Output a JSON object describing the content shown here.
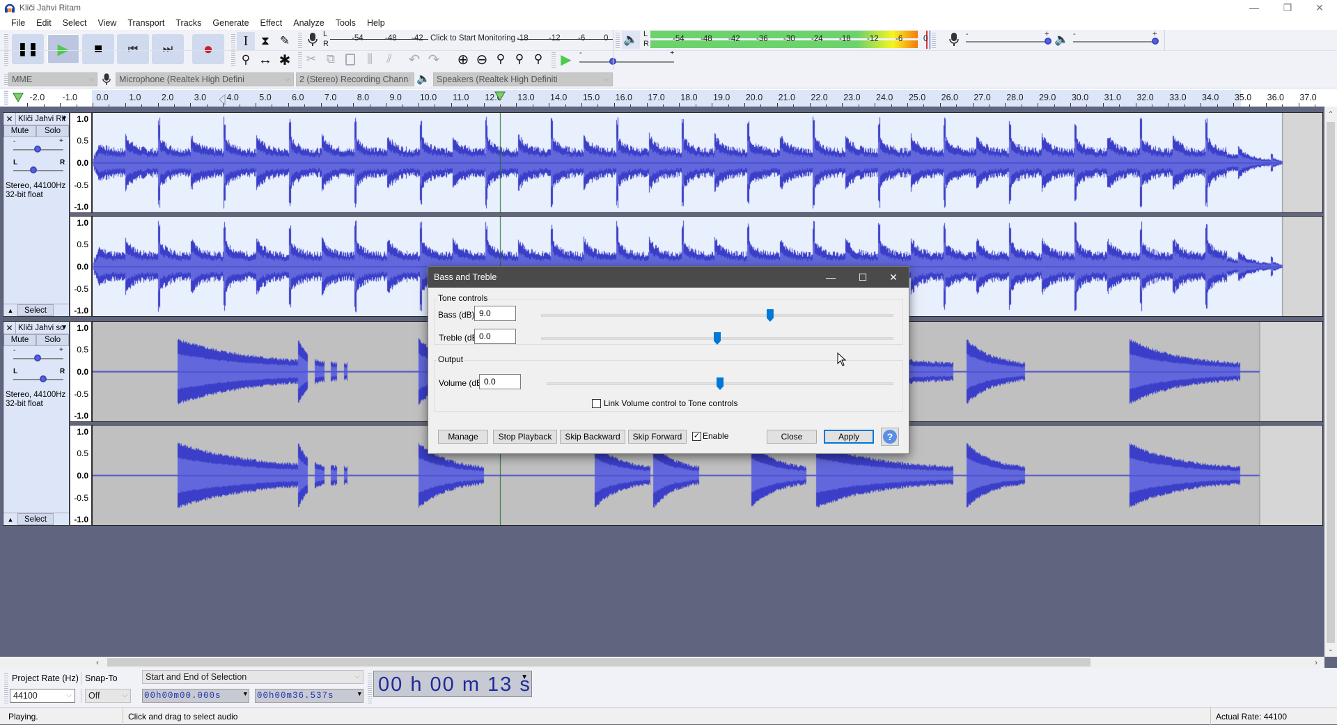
{
  "window": {
    "title": "Kliči Jahvi Ritam",
    "controls": {
      "minimize": "—",
      "restore": "❐",
      "close": "✕"
    }
  },
  "menu": [
    "File",
    "Edit",
    "Select",
    "View",
    "Transport",
    "Tracks",
    "Generate",
    "Effect",
    "Analyze",
    "Tools",
    "Help"
  ],
  "transport": {
    "buttons": [
      {
        "name": "pause",
        "glyph": "❚❚"
      },
      {
        "name": "play",
        "glyph": "▶",
        "active": true
      },
      {
        "name": "stop",
        "glyph": "■"
      },
      {
        "name": "skip-start",
        "glyph": "⏮"
      },
      {
        "name": "skip-end",
        "glyph": "⏭"
      },
      {
        "name": "record",
        "glyph": "●"
      }
    ]
  },
  "tools": {
    "row1": [
      {
        "name": "selection-tool",
        "glyph": "I",
        "selected": true
      },
      {
        "name": "envelope-tool",
        "glyph": "⧗"
      },
      {
        "name": "draw-tool",
        "glyph": "✎"
      }
    ],
    "row2": [
      {
        "name": "zoom-tool",
        "glyph": "⚲"
      },
      {
        "name": "timeshift-tool",
        "glyph": "↔"
      },
      {
        "name": "multi-tool",
        "glyph": "✱"
      }
    ]
  },
  "edit_tools": [
    {
      "name": "cut",
      "glyph": "✂"
    },
    {
      "name": "copy",
      "glyph": "⧉"
    },
    {
      "name": "paste",
      "glyph": "📋"
    },
    {
      "name": "trim",
      "glyph": "⫼"
    },
    {
      "name": "silence",
      "glyph": "⫽"
    },
    {
      "name": "undo",
      "glyph": "↶"
    },
    {
      "name": "redo",
      "glyph": "↷"
    },
    {
      "name": "zoom-in",
      "glyph": "⊕"
    },
    {
      "name": "zoom-out",
      "glyph": "⊖"
    },
    {
      "name": "fit-selection",
      "glyph": "⚲"
    },
    {
      "name": "fit-project",
      "glyph": "⚲"
    },
    {
      "name": "zoom-toggle",
      "glyph": "⚲"
    }
  ],
  "play_at_speed": {
    "glyph": "▶",
    "min": "-",
    "max": "+",
    "value_fraction": 0.35
  },
  "record_meter": {
    "L": "L",
    "R": "R",
    "ticks": [
      "-54",
      "-48",
      "-42",
      "-18",
      "-12",
      "-6",
      "0"
    ],
    "prompt": "Click to Start Monitoring"
  },
  "playback_meter": {
    "L": "L",
    "R": "R",
    "ticks": [
      "-54",
      "-48",
      "-42",
      "-36",
      "-30",
      "-24",
      "-18",
      "-12",
      "-6",
      "0"
    ],
    "colors": {
      "green": "#6cd26c",
      "yellow": "#f5f51e",
      "orange": "#f57a10",
      "peak": "#e23030"
    }
  },
  "mixer": {
    "record_volume": {
      "min": "-",
      "max": "+",
      "value_fraction": 1.0
    },
    "playback_volume": {
      "min": "-",
      "max": "+",
      "value_fraction": 1.0
    }
  },
  "device": {
    "host": "MME",
    "recording_device": "Microphone (Realtek High Defini",
    "channels": "2 (Stereo) Recording Chann",
    "playback_device": "Speakers (Realtek High Definiti"
  },
  "ruler": {
    "ticks": [
      "-2.0",
      "-1.0",
      "0.0",
      "1.0",
      "2.0",
      "3.0",
      "4.0",
      "5.0",
      "6.0",
      "7.0",
      "8.0",
      "9.0",
      "10.0",
      "11.0",
      "12.0",
      "13.0",
      "14.0",
      "15.0",
      "16.0",
      "17.0",
      "18.0",
      "19.0",
      "20.0",
      "21.0",
      "22.0",
      "23.0",
      "24.0",
      "25.0",
      "26.0",
      "27.0",
      "28.0",
      "29.0",
      "30.0",
      "31.0",
      "32.0",
      "33.0",
      "34.0",
      "35.0",
      "36.0",
      "37.0"
    ],
    "playhead_seconds": 12.5
  },
  "tracks": [
    {
      "name": "Kliči Jahvi Ritam",
      "name_display": "Kliči Jahvi Rit",
      "mute": "Mute",
      "solo": "Solo",
      "gain": {
        "min": "-",
        "max": "+"
      },
      "pan": {
        "left": "L",
        "right": "R"
      },
      "info_line1": "Stereo, 44100Hz",
      "info_line2": "32-bit float",
      "select": "Select",
      "selected": true,
      "amplitude_labels": [
        "1.0",
        "0.5",
        "0.0",
        "-0.5",
        "-1.0"
      ],
      "end_seconds": 36.5
    },
    {
      "name": "Kliči Jahvi so",
      "name_display": "Kliči Jahvi so",
      "mute": "Mute",
      "solo": "Solo",
      "gain": {
        "min": "-",
        "max": "+"
      },
      "pan": {
        "left": "L",
        "right": "R"
      },
      "info_line1": "Stereo, 44100Hz",
      "info_line2": "32-bit float",
      "select": "Select",
      "selected": false,
      "amplitude_labels": [
        "1.0",
        "0.5",
        "0.0",
        "-0.5",
        "-1.0"
      ],
      "end_seconds": 35.8
    }
  ],
  "dialog": {
    "title": "Bass and Treble",
    "tone_group": "Tone controls",
    "bass_label": "Bass (dB):",
    "bass_value": "9.0",
    "bass_slider_fraction": 0.65,
    "treble_label": "Treble (dB):",
    "treble_value": "0.0",
    "treble_slider_fraction": 0.5,
    "output_group": "Output",
    "volume_label": "Volume (dB):",
    "volume_value": "0.0",
    "volume_slider_fraction": 0.5,
    "link_label": "Link Volume control to Tone controls",
    "link_checked": false,
    "buttons": {
      "manage": "Manage",
      "stop_playback": "Stop Playback",
      "skip_backward": "Skip Backward",
      "skip_forward": "Skip Forward",
      "enable": "Enable",
      "close": "Close",
      "apply": "Apply",
      "help": "?"
    },
    "enable_checked": true
  },
  "selection_toolbar": {
    "project_rate_label": "Project Rate (Hz)",
    "project_rate": "44100",
    "snap_label": "Snap-To",
    "snap_value": "Off",
    "mode": "Start and End of Selection",
    "start": "00h00m00.000s",
    "end": "00h00m36.537s",
    "audio_position": "00 h 00 m 13 s"
  },
  "status": {
    "state": "Playing.",
    "hint": "Click and drag to select audio",
    "actual_rate": "Actual Rate: 44100"
  }
}
